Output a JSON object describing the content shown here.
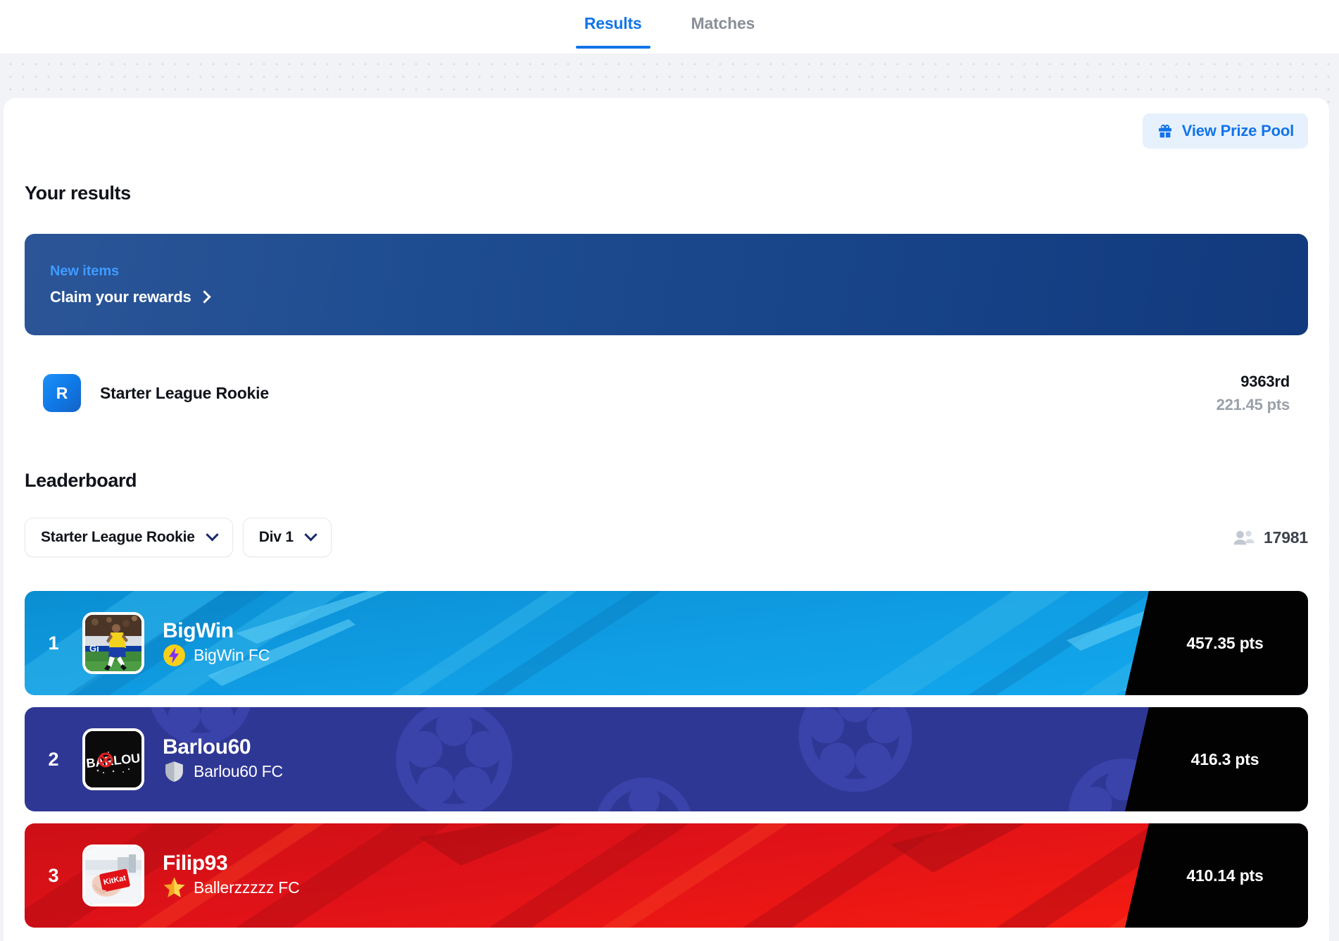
{
  "tabs": [
    {
      "label": "Results",
      "active": true
    },
    {
      "label": "Matches",
      "active": false
    }
  ],
  "toolbar": {
    "prize_pool_label": "View Prize Pool",
    "prize_pool_icon": "gift-icon"
  },
  "your_results": {
    "heading": "Your results",
    "banner": {
      "kicker": "New items",
      "cta": "Claim your rewards",
      "arrow_icon": "chevron-right-icon"
    },
    "entry": {
      "badge_letter": "R",
      "league": "Starter League Rookie",
      "rank": "9363rd",
      "points": "221.45 pts"
    }
  },
  "leaderboard": {
    "heading": "Leaderboard",
    "filters": [
      {
        "name": "league-filter",
        "value": "Starter League Rookie",
        "icon": "chevron-down-icon"
      },
      {
        "name": "division-filter",
        "value": "Div 1",
        "icon": "chevron-down-icon"
      }
    ],
    "participants": {
      "icon": "people-icon",
      "count": "17981"
    },
    "rows": [
      {
        "rank": "1",
        "username": "BigWin",
        "team": "BigWin FC",
        "points": "457.35 pts",
        "theme": "blue",
        "badge_icon": "lightning-badge-icon",
        "avatar_icon": "footballer-photo-avatar"
      },
      {
        "rank": "2",
        "username": "Barlou60",
        "team": "Barlou60 FC",
        "points": "416.3 pts",
        "theme": "indigo",
        "badge_icon": "shield-badge-icon",
        "avatar_icon": "barlou-logo-avatar"
      },
      {
        "rank": "3",
        "username": "Filip93",
        "team": "Ballerzzzzz FC",
        "points": "410.14 pts",
        "theme": "red",
        "badge_icon": "star-badge-icon",
        "avatar_icon": "kitkat-photo-avatar"
      }
    ]
  },
  "colors": {
    "accent_blue": "#1274e8",
    "banner_blue": "#1f4d91",
    "row1_blue": "#0f9ae0",
    "row2_indigo": "#2f3795",
    "row3_red": "#d81118",
    "points_black": "#020203"
  }
}
